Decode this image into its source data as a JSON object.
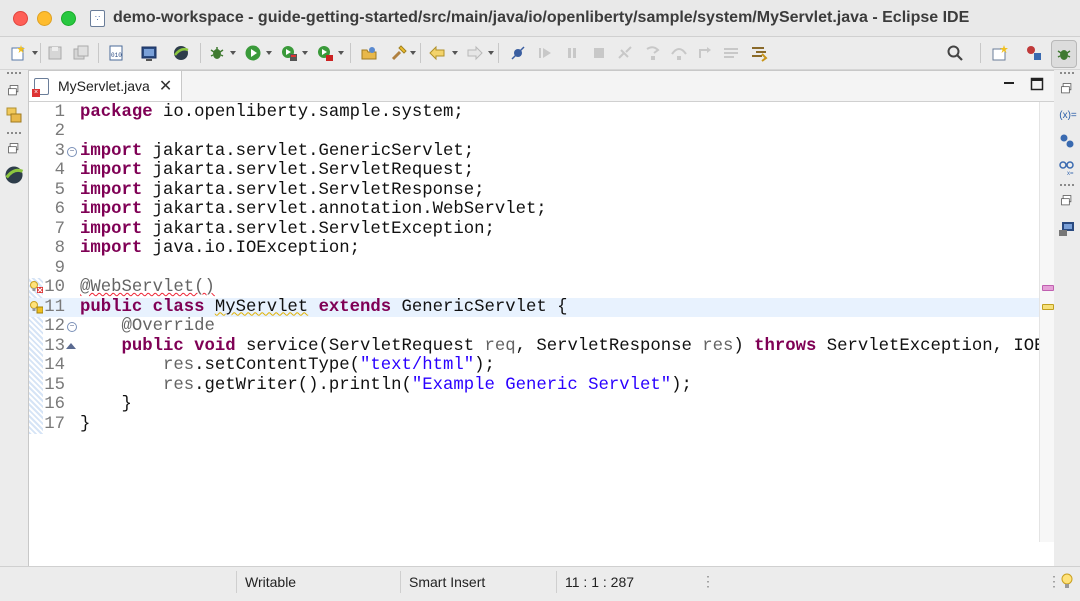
{
  "window": {
    "title": "demo-workspace - guide-getting-started/src/main/java/io/openliberty/sample/system/MyServlet.java - Eclipse IDE",
    "title_doc_glyph": "∵"
  },
  "toolbar": {
    "items": [
      "new-icon",
      "save-icon",
      "save-all-icon",
      "binary-icon",
      "console-icon",
      "liberty-icon",
      "debug-icon",
      "run-icon",
      "coverage-icon",
      "external-tools-icon",
      "open-type-icon",
      "search-flashlight-icon",
      "back-icon",
      "forward-icon",
      "skip-breakpoints-icon",
      "resume-icon",
      "suspend-icon",
      "terminate-icon",
      "disconnect-icon",
      "step-into-icon",
      "step-over-icon",
      "step-return-icon",
      "drop-to-frame-icon",
      "use-step-filters-icon",
      "search-icon",
      "open-perspective-icon",
      "java-perspective-icon",
      "debug-perspective-icon"
    ]
  },
  "editor": {
    "tab_label": "MyServlet.java",
    "tab_close": "✕",
    "tab_error_glyph": "×",
    "fold_open_glyph": "−",
    "lines": [
      {
        "n": "1",
        "segs": [
          {
            "t": "package",
            "c": "kw"
          },
          {
            "t": " io.openliberty.sample.system;",
            "c": ""
          }
        ]
      },
      {
        "n": "2",
        "segs": []
      },
      {
        "n": "3",
        "fold": "open",
        "segs": [
          {
            "t": "import",
            "c": "kw"
          },
          {
            "t": " jakarta.servlet.GenericServlet;",
            "c": ""
          }
        ]
      },
      {
        "n": "4",
        "segs": [
          {
            "t": "import",
            "c": "kw"
          },
          {
            "t": " jakarta.servlet.ServletRequest;",
            "c": ""
          }
        ]
      },
      {
        "n": "5",
        "segs": [
          {
            "t": "import",
            "c": "kw"
          },
          {
            "t": " jakarta.servlet.ServletResponse;",
            "c": ""
          }
        ]
      },
      {
        "n": "6",
        "segs": [
          {
            "t": "import",
            "c": "kw"
          },
          {
            "t": " jakarta.servlet.annotation.WebServlet;",
            "c": ""
          }
        ]
      },
      {
        "n": "7",
        "segs": [
          {
            "t": "import",
            "c": "kw"
          },
          {
            "t": " jakarta.servlet.ServletException;",
            "c": ""
          }
        ]
      },
      {
        "n": "8",
        "segs": [
          {
            "t": "import",
            "c": "kw"
          },
          {
            "t": " java.io.IOException;",
            "c": ""
          }
        ]
      },
      {
        "n": "9",
        "segs": []
      },
      {
        "n": "10",
        "marker": "error",
        "segs": [
          {
            "t": "@WebServlet()",
            "c": "ann err-under"
          }
        ]
      },
      {
        "n": "11",
        "marker": "warning",
        "current": true,
        "segs": [
          {
            "t": "public",
            "c": "kw"
          },
          {
            "t": " ",
            "c": ""
          },
          {
            "t": "class",
            "c": "kw"
          },
          {
            "t": " ",
            "c": ""
          },
          {
            "t": "MyServlet",
            "c": "warn-under"
          },
          {
            "t": " ",
            "c": ""
          },
          {
            "t": "extends",
            "c": "kw"
          },
          {
            "t": " GenericServlet {",
            "c": ""
          }
        ]
      },
      {
        "n": "12",
        "fold": "open",
        "segs": [
          {
            "t": "    @Override",
            "c": "ann"
          }
        ]
      },
      {
        "n": "13",
        "fold": "override",
        "segs": [
          {
            "t": "    ",
            "c": ""
          },
          {
            "t": "public",
            "c": "kw"
          },
          {
            "t": " ",
            "c": ""
          },
          {
            "t": "void",
            "c": "kw"
          },
          {
            "t": " service(ServletRequest ",
            "c": ""
          },
          {
            "t": "req",
            "c": "ann"
          },
          {
            "t": ", ServletResponse ",
            "c": ""
          },
          {
            "t": "res",
            "c": "ann"
          },
          {
            "t": ") ",
            "c": ""
          },
          {
            "t": "throws",
            "c": "kw"
          },
          {
            "t": " ServletException, IOE:",
            "c": ""
          }
        ]
      },
      {
        "n": "14",
        "segs": [
          {
            "t": "        ",
            "c": ""
          },
          {
            "t": "res",
            "c": "ann"
          },
          {
            "t": ".setContentType(",
            "c": ""
          },
          {
            "t": "\"text/html\"",
            "c": "str"
          },
          {
            "t": ");",
            "c": ""
          }
        ]
      },
      {
        "n": "15",
        "segs": [
          {
            "t": "        ",
            "c": ""
          },
          {
            "t": "res",
            "c": "ann"
          },
          {
            "t": ".getWriter().println(",
            "c": ""
          },
          {
            "t": "\"Example Generic Servlet\"",
            "c": "str"
          },
          {
            "t": ");",
            "c": ""
          }
        ]
      },
      {
        "n": "16",
        "segs": [
          {
            "t": "    }",
            "c": ""
          }
        ]
      },
      {
        "n": "17",
        "segs": [
          {
            "t": "}",
            "c": ""
          }
        ]
      }
    ]
  },
  "right_panel": {
    "variables_label": "(x)="
  },
  "status": {
    "writable": "Writable",
    "insert_mode": "Smart Insert",
    "position": "11 : 1 : 287",
    "more_glyph": "⋮"
  },
  "colors": {
    "keyword": "#7f0055",
    "string": "#2a00ff",
    "annotation": "#646464",
    "current_line": "#e8f2fe"
  }
}
